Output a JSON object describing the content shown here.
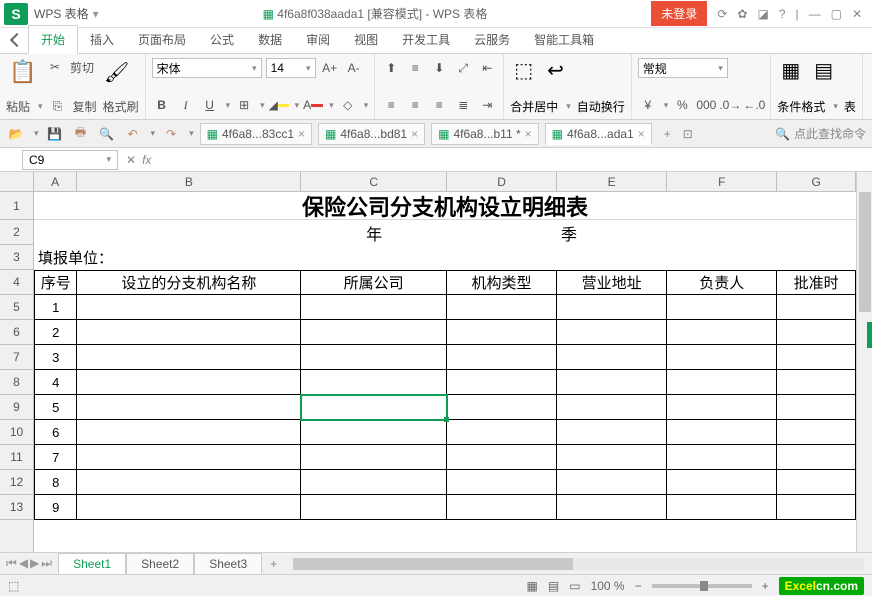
{
  "titlebar": {
    "app_name": "WPS 表格",
    "doc_title": "4f6a8f038aada1 [兼容模式] - WPS 表格",
    "not_logged": "未登录"
  },
  "menu": {
    "items": [
      "开始",
      "插入",
      "页面布局",
      "公式",
      "数据",
      "审阅",
      "视图",
      "开发工具",
      "云服务",
      "智能工具箱"
    ],
    "active_index": 0
  },
  "ribbon": {
    "cut": "剪切",
    "paste": "粘贴",
    "copy": "复制",
    "format_painter": "格式刷",
    "font_name": "宋体",
    "font_size": "14",
    "merge_center": "合并居中",
    "auto_wrap": "自动换行",
    "number_format": "常规",
    "cond_fmt": "条件格式",
    "table_tool": "表"
  },
  "doctabs": {
    "items": [
      {
        "label": "4f6a8...83cc1",
        "suffix": "×"
      },
      {
        "label": "4f6a8...bd81",
        "suffix": "×"
      },
      {
        "label": "4f6a8...b11 *",
        "suffix": "×"
      },
      {
        "label": "4f6a8...ada1",
        "suffix": "×"
      }
    ],
    "active_index": 3,
    "search_placeholder": "点此查找命令"
  },
  "namebox": {
    "ref": "C9"
  },
  "grid": {
    "columns": [
      "A",
      "B",
      "C",
      "D",
      "E",
      "F",
      "G"
    ],
    "row_numbers": [
      1,
      2,
      3,
      4,
      5,
      6,
      7,
      8,
      9,
      10,
      11,
      12,
      13
    ],
    "title": "保险公司分支机构设立明细表",
    "subtitle_year": "年",
    "subtitle_quarter": "季",
    "report_unit": "填报单位：",
    "headers": [
      "序号",
      "设立的分支机构名称",
      "所属公司",
      "机构类型",
      "营业地址",
      "负责人",
      "批准时"
    ],
    "seq": [
      "1",
      "2",
      "3",
      "4",
      "5",
      "6",
      "7",
      "8",
      "9"
    ],
    "selected": "C9"
  },
  "sheets": {
    "items": [
      "Sheet1",
      "Sheet2",
      "Sheet3"
    ],
    "active_index": 0
  },
  "status": {
    "zoom": "100 %",
    "watermark_a": "Excel",
    "watermark_b": "cn.com"
  }
}
